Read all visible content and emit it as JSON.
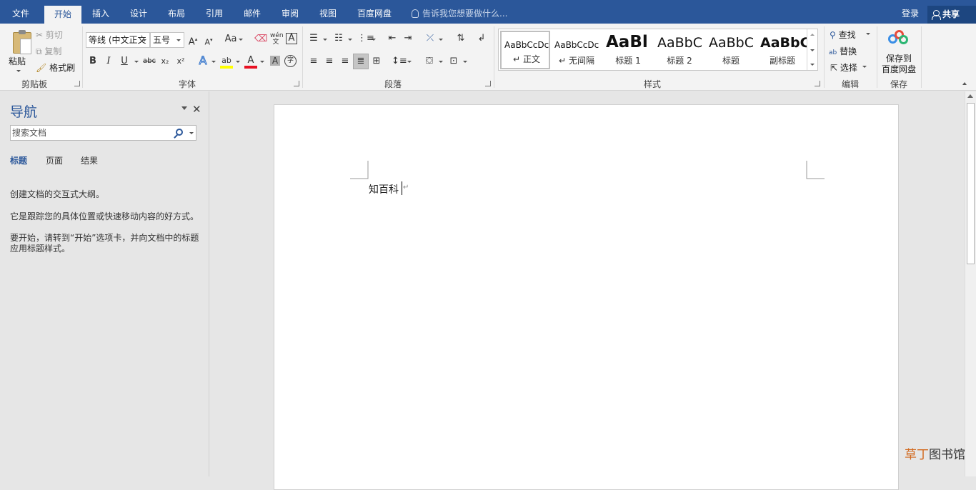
{
  "tabs": [
    "文件",
    "开始",
    "插入",
    "设计",
    "布局",
    "引用",
    "邮件",
    "审阅",
    "视图",
    "百度网盘"
  ],
  "active_tab": "开始",
  "tell_me_placeholder": "告诉我您想要做什么...",
  "account": {
    "login": "登录",
    "share": "共享"
  },
  "clipboard": {
    "paste": "粘贴",
    "cut": "剪切",
    "copy": "复制",
    "format_painter": "格式刷",
    "label": "剪贴板"
  },
  "font": {
    "family_value": "等线 (中文正文",
    "size_value": "五号",
    "grow": "A",
    "shrink": "A",
    "change_case": "Aa",
    "phonetic": "wén",
    "border_char": "A",
    "bold": "B",
    "italic": "I",
    "underline": "U",
    "strikethrough": "abc",
    "subscript": "x₂",
    "superscript": "x²",
    "text_effects": "A",
    "font_color": "A",
    "char_shading": "A",
    "enclose": "字",
    "label": "字体"
  },
  "paragraph": {
    "label": "段落"
  },
  "styles": {
    "items": [
      {
        "sample": "AaBbCcDc",
        "name": "正文",
        "para_mark": "↵"
      },
      {
        "sample": "AaBbCcDc",
        "name": "无间隔",
        "para_mark": "↵"
      },
      {
        "sample": "AaBl",
        "name": "标题 1"
      },
      {
        "sample": "AaBbC",
        "name": "标题 2"
      },
      {
        "sample": "AaBbC",
        "name": "标题"
      },
      {
        "sample": "AaBbC",
        "name": "副标题"
      }
    ],
    "label": "样式"
  },
  "editing": {
    "find": "查找",
    "replace": "替换",
    "select": "选择",
    "label": "编辑"
  },
  "save": {
    "button_line1": "保存到",
    "button_line2": "百度网盘",
    "label": "保存"
  },
  "navigation": {
    "title": "导航",
    "search_placeholder": "搜索文档",
    "tabs": [
      "标题",
      "页面",
      "结果"
    ],
    "active_tab": "标题",
    "hint_1": "创建文档的交互式大纲。",
    "hint_2": "它是跟踪您的具体位置或快速移动内容的好方式。",
    "hint_3": "要开始，请转到“开始”选项卡，并向文档中的标题应用标题样式。"
  },
  "document": {
    "body_text": "知百科",
    "para_mark": "↵"
  },
  "watermark": {
    "accent": "草丁",
    "rest": "图书馆"
  },
  "colors": {
    "title_bar": "#2b579a",
    "highlight": "#ffff00",
    "font_color": "#e81123"
  }
}
